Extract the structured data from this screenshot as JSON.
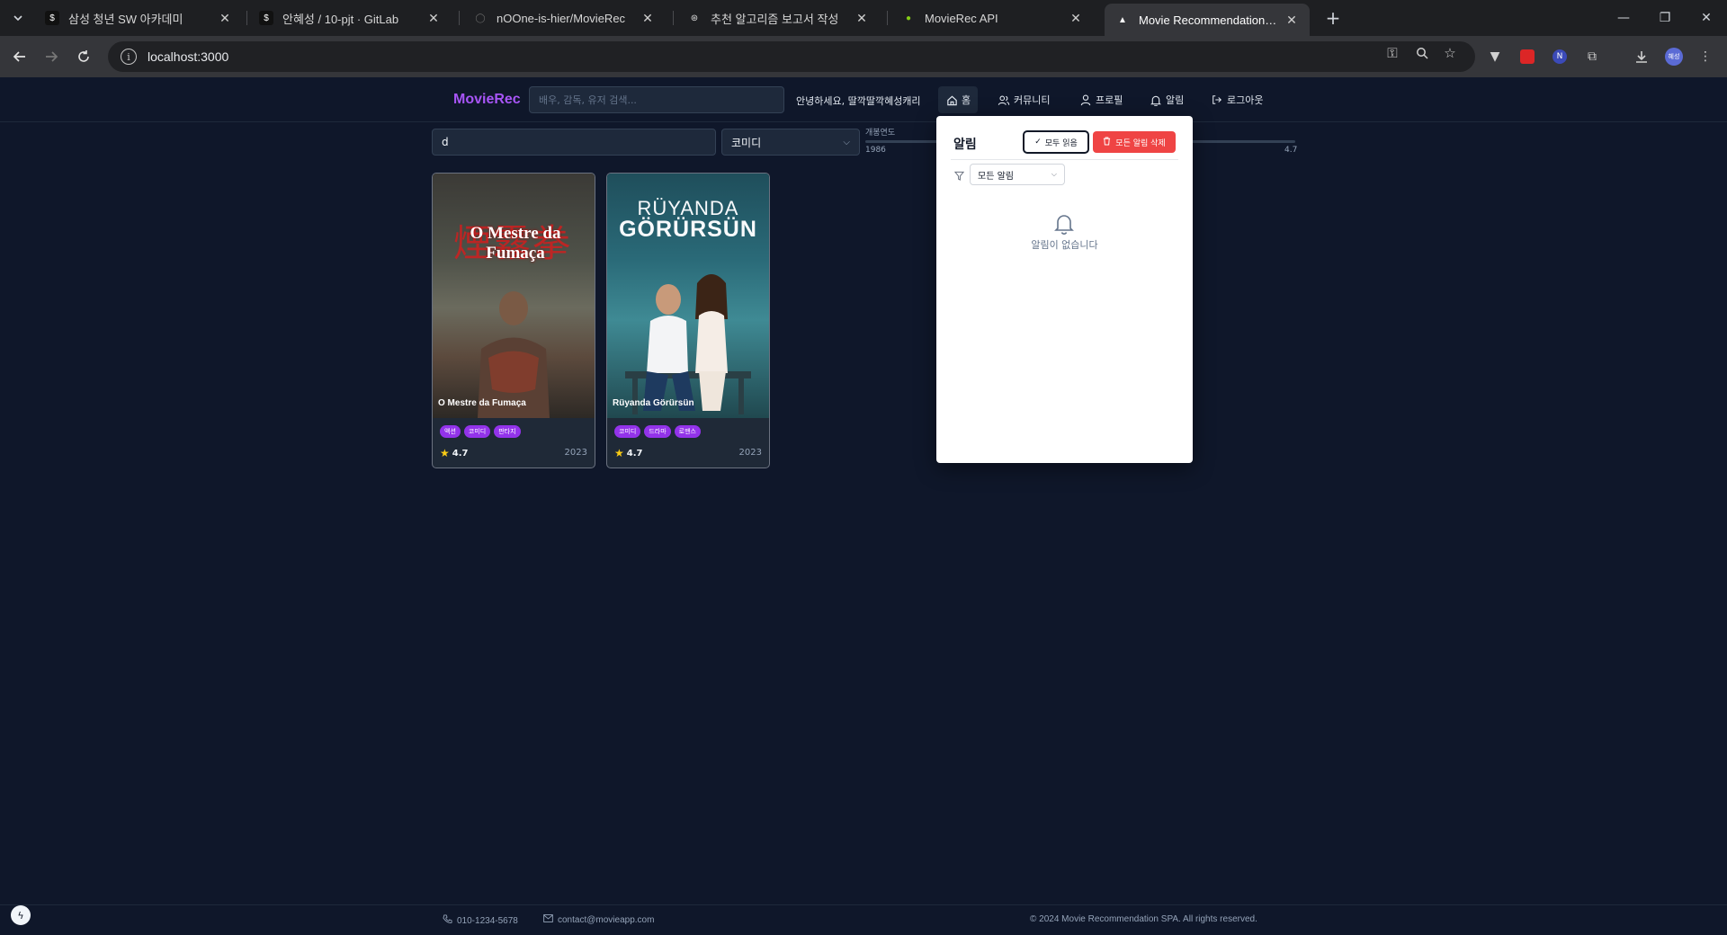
{
  "browser": {
    "tabs": [
      {
        "title": "삼성 청년 SW 아카데미",
        "fav_color": "#111111",
        "fav_glyph": "$"
      },
      {
        "title": "안혜성 / 10-pjt · GitLab",
        "fav_color": "#111111",
        "fav_glyph": "$"
      },
      {
        "title": "nOOne-is-hier/MovieRec",
        "fav_color": "#2d2d2d",
        "fav_glyph": "◯"
      },
      {
        "title": "추천 알고리즘 보고서 작성",
        "fav_color": "#2d2d2d",
        "fav_glyph": "⊛"
      },
      {
        "title": "MovieRec API",
        "fav_color": "#65a30d",
        "fav_glyph": "●"
      },
      {
        "title": "Movie Recommendation SPA",
        "fav_color": "#111111",
        "fav_glyph": "▲"
      }
    ],
    "url": "localhost:3000",
    "profile_initials": "혜성"
  },
  "navbar": {
    "brand": "MovieRec",
    "search_placeholder": "배우, 감독, 유저 검색...",
    "greeting": "안녕하세요, 딸깍딸깍혜성캐리",
    "items": [
      {
        "label": "홈",
        "icon": "home-icon"
      },
      {
        "label": "커뮤니티",
        "icon": "users-icon"
      },
      {
        "label": "프로필",
        "icon": "user-icon"
      },
      {
        "label": "알림",
        "icon": "bell-icon"
      },
      {
        "label": "로그아웃",
        "icon": "logout-icon"
      }
    ]
  },
  "filters": {
    "query_value": "d",
    "genre_value": "코미디",
    "year_label": "개봉연도",
    "year_min": "1986",
    "rating_value": "4.7"
  },
  "movies": [
    {
      "title": "O Mestre da Fumaça",
      "poster_text": "O Mestre da Fumaça",
      "poster_cjk": "煙霧拳",
      "genres": [
        "액션",
        "코미디",
        "판타지"
      ],
      "rating": "4.7",
      "year": "2023"
    },
    {
      "title": "Rüyanda Görürsün",
      "poster_text_1": "RÜYANDA",
      "poster_text_2": "GÖRÜRSÜN",
      "genres": [
        "코미디",
        "드라마",
        "로맨스"
      ],
      "rating": "4.7",
      "year": "2023"
    }
  ],
  "notifications": {
    "title": "알림",
    "read_all_label": "모두 읽음",
    "delete_all_label": "모든 알림 삭제",
    "filter_value": "모든 알림",
    "empty_text": "알림이 없습니다"
  },
  "footer": {
    "phone": "010-1234-5678",
    "email": "contact@movieapp.com",
    "copyright": "© 2024 Movie Recommendation SPA. All rights reserved."
  },
  "colors": {
    "accent": "#a855f7",
    "tag": "#9333ea",
    "danger": "#ef4444",
    "star": "#facc15",
    "background": "#0f172a"
  }
}
